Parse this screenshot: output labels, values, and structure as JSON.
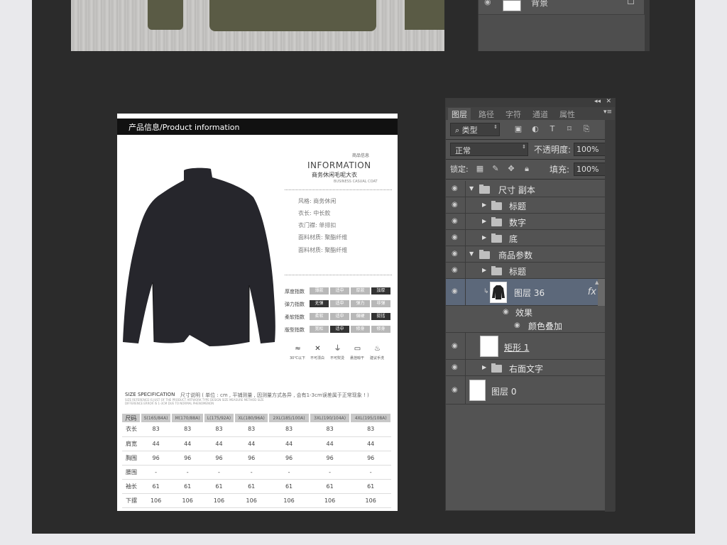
{
  "colors": {
    "workspace": "#2b2b2b",
    "panel": "#535353",
    "selected_row": "#5c687a",
    "olive": "#5a5b45"
  },
  "top_panel": {
    "layer_label": "背景"
  },
  "document": {
    "header": "产品信息/Product information",
    "small_label": "商品信息",
    "title": "INFORMATION",
    "subtitle": "商务休闲毛呢大衣",
    "tiny_label": "BUSINESS CASUAL COAT",
    "attributes": [
      "风格: 商务休闲",
      "衣长: 中长款",
      "衣门襟: 单排扣",
      "面料材质: 聚酯纤维",
      "面料材质: 聚酯纤维"
    ],
    "ratings": [
      {
        "label": "厚度指数",
        "options": [
          "薄款",
          "适中",
          "厚款",
          "加厚"
        ],
        "selected": 3
      },
      {
        "label": "弹力指数",
        "options": [
          "无弹",
          "适中",
          "弹力",
          "非弹"
        ],
        "selected": 0
      },
      {
        "label": "柔软指数",
        "options": [
          "柔软",
          "适中",
          "偏硬",
          "挺括"
        ],
        "selected": 3
      },
      {
        "label": "版型指数",
        "options": [
          "宽松",
          "适中",
          "修身",
          "修身"
        ],
        "selected": 1
      }
    ],
    "care": [
      {
        "icon": "wash-30-icon",
        "glyph": "≈",
        "label": "30℃以下"
      },
      {
        "icon": "no-bleach-icon",
        "glyph": "✕",
        "label": "不可漂白"
      },
      {
        "icon": "no-iron-icon",
        "glyph": "⏚",
        "label": "不可熨烫"
      },
      {
        "icon": "hang-dry-icon",
        "glyph": "▭",
        "label": "悬挂晾干"
      },
      {
        "icon": "hand-wash-icon",
        "glyph": "♨",
        "label": "建议手洗"
      }
    ],
    "size_title": "SIZE SPECIFICATION",
    "size_note": "尺寸说明 ( 单位 : cm , 平铺测量 , 因测量方式各异 , 会有1-3cm误差属于正常现象 ! )",
    "size_tiny": "SIZE REFERENCE IS JUST OF THE PRODUCT ARTWORK TYPE DESIGN SIZE MEASURE METHOD SIZE DIFFERENCE ERROR IS 1-3CM DUE TO NORMAL PHENOMENON",
    "size_table": {
      "headers": [
        "尺码",
        "S(165/84A)",
        "M(170/88A)",
        "L(175/92A)",
        "XL(180/96A)",
        "2XL(185/100A)",
        "3XL(190/104A)",
        "4XL(195/108A)"
      ],
      "rows": [
        [
          "衣长",
          "83",
          "83",
          "83",
          "83",
          "83",
          "83",
          "83"
        ],
        [
          "肩宽",
          "44",
          "44",
          "44",
          "44",
          "44",
          "44",
          "44"
        ],
        [
          "胸围",
          "96",
          "96",
          "96",
          "96",
          "96",
          "96",
          "96"
        ],
        [
          "腰围",
          "-",
          "-",
          "-",
          "-",
          "-",
          "-",
          "-"
        ],
        [
          "袖长",
          "61",
          "61",
          "61",
          "61",
          "61",
          "61",
          "61"
        ],
        [
          "下摆",
          "106",
          "106",
          "106",
          "106",
          "106",
          "106",
          "106"
        ]
      ]
    }
  },
  "layers_panel": {
    "tabs": [
      "图层",
      "路径",
      "字符",
      "通道",
      "属性"
    ],
    "filter_kind": "类型",
    "blend_mode": "正常",
    "opacity_label": "不透明度:",
    "opacity_value": "100%",
    "lock_label": "锁定:",
    "fill_label": "填充:",
    "fill_value": "100%",
    "layers": [
      {
        "name": "尺寸 副本",
        "type": "group",
        "expanded": true,
        "depth": 0
      },
      {
        "name": "标题",
        "type": "group",
        "expanded": false,
        "depth": 1
      },
      {
        "name": "数字",
        "type": "group",
        "expanded": false,
        "depth": 1
      },
      {
        "name": "底",
        "type": "group",
        "expanded": false,
        "depth": 1
      },
      {
        "name": "商品参数",
        "type": "group",
        "expanded": true,
        "depth": 0
      },
      {
        "name": "标题",
        "type": "group",
        "expanded": false,
        "depth": 1
      },
      {
        "name": "图层 36",
        "type": "layer",
        "selected": true
      },
      {
        "name": "矩形 1",
        "type": "shape"
      },
      {
        "name": "右面文字",
        "type": "group",
        "expanded": false,
        "depth": 1
      },
      {
        "name": "图层 0",
        "type": "layer"
      }
    ],
    "effects_label": "效果",
    "effect_item": "颜色叠加",
    "fx_label": "fx"
  }
}
